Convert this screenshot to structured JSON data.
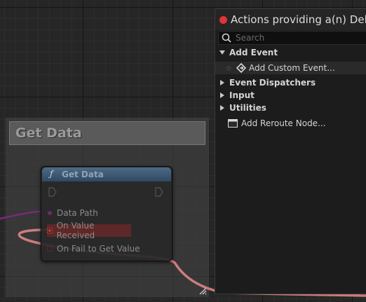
{
  "comment": {
    "title": "Get Data"
  },
  "node": {
    "function_icon": "ƒ",
    "title": "Get Data",
    "pins": {
      "data_path": "Data Path",
      "on_value_received": "On Value Received",
      "on_fail": "On Fail to Get Value"
    },
    "colors": {
      "header": "#3f5c78",
      "wire": "#e88a8a",
      "data_pin": "#8a2a8a",
      "delegate_pin": "#c23a3a"
    }
  },
  "panel": {
    "title": "Actions providing a(n) Delegate",
    "search_placeholder": "Search",
    "items": [
      {
        "kind": "category",
        "expanded": true,
        "label": "Add Event"
      },
      {
        "kind": "action",
        "icon": "event-icon",
        "label": "Add Custom Event..."
      },
      {
        "kind": "category",
        "expanded": false,
        "label": "Event Dispatchers"
      },
      {
        "kind": "category",
        "expanded": false,
        "label": "Input"
      },
      {
        "kind": "category",
        "expanded": false,
        "label": "Utilities"
      },
      {
        "kind": "action",
        "icon": "reroute-node-icon",
        "label": "Add Reroute Node..."
      }
    ]
  }
}
